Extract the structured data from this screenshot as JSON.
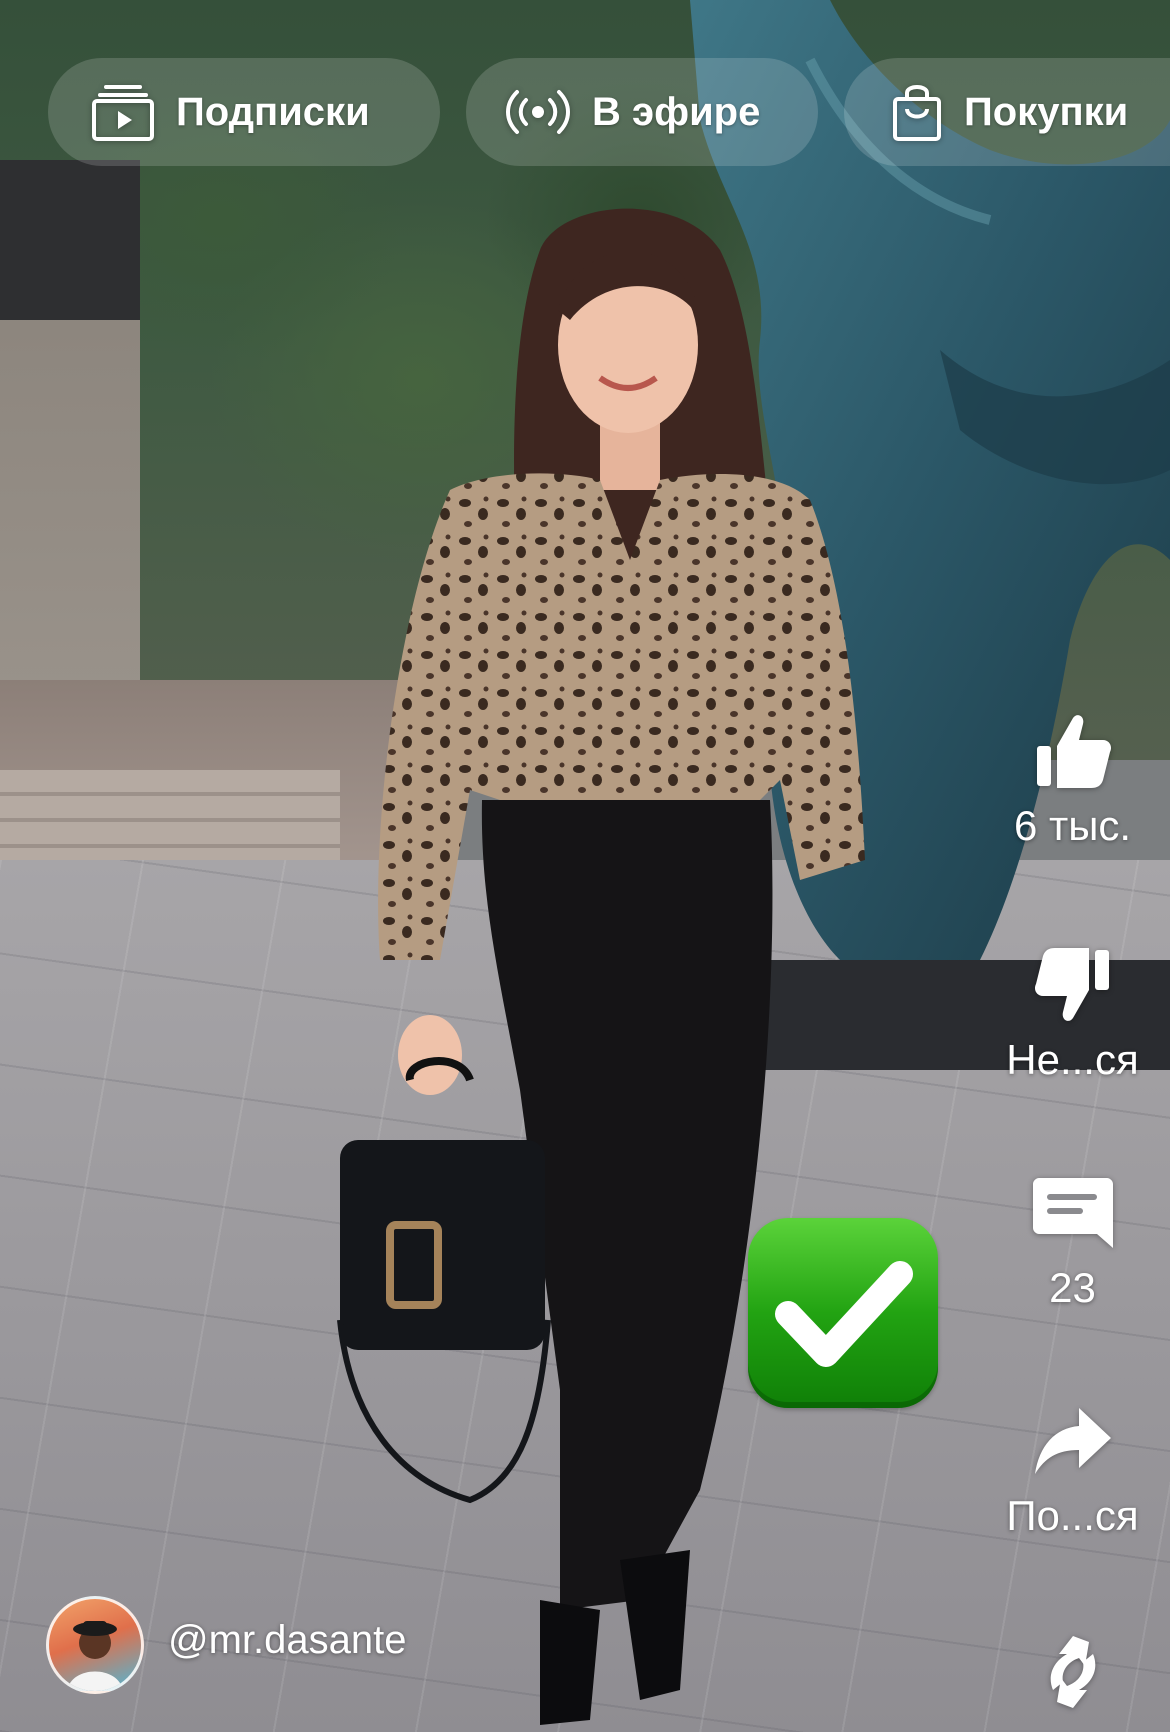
{
  "tabs": [
    {
      "label": "Подписки",
      "icon": "subscriptions-icon"
    },
    {
      "label": "В эфире",
      "icon": "live-broadcast-icon"
    },
    {
      "label": "Покупки",
      "icon": "shopping-bag-icon"
    }
  ],
  "actions": {
    "like": {
      "label": "6 тыс.",
      "icon": "thumbs-up-icon"
    },
    "dislike": {
      "label": "Не...ся",
      "icon": "thumbs-down-icon"
    },
    "comments": {
      "label": "23",
      "icon": "comment-icon"
    },
    "share": {
      "label": "По...ся",
      "icon": "share-icon"
    },
    "remix": {
      "icon": "remix-icon"
    }
  },
  "overlay": {
    "icon": "check-mark-button-emoji"
  },
  "author": {
    "handle": "@mr.dasante",
    "avatar": "author-avatar"
  },
  "colors": {
    "sculpture": "#2e5a6a",
    "emoji_green": "#22a312"
  }
}
